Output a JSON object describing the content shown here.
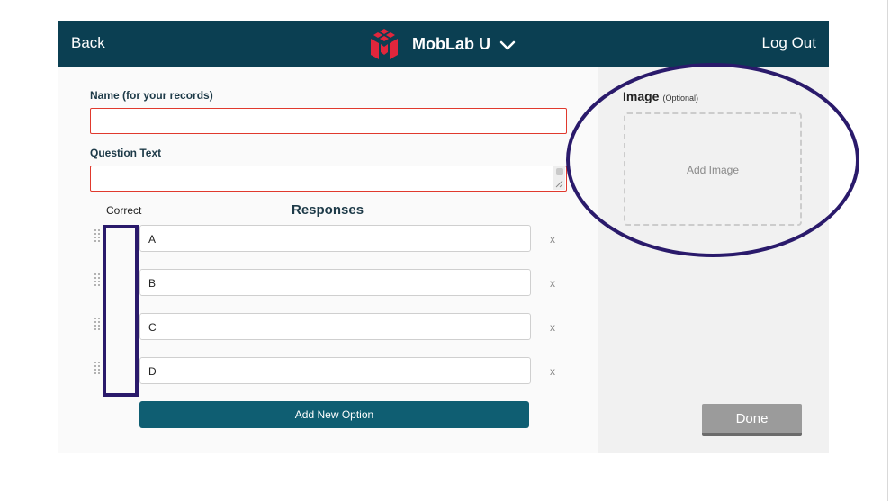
{
  "header": {
    "back_label": "Back",
    "brand_name": "MobLab U",
    "logout_label": "Log Out",
    "brand_color": "#e1263c",
    "bar_color": "#0b3f52"
  },
  "form": {
    "name_label": "Name (for your records)",
    "name_value": "",
    "question_label": "Question Text",
    "question_value": "",
    "correct_label": "Correct",
    "responses_title": "Responses",
    "responses": [
      {
        "value": "A",
        "remove_label": "x"
      },
      {
        "value": "B",
        "remove_label": "x"
      },
      {
        "value": "C",
        "remove_label": "x"
      },
      {
        "value": "D",
        "remove_label": "x"
      }
    ],
    "add_option_label": "Add New Option"
  },
  "side": {
    "image_title": "Image",
    "image_optional": "(Optional)",
    "add_image_label": "Add Image",
    "done_label": "Done"
  },
  "annotation": {
    "highlight_color": "#2a1a6b"
  }
}
